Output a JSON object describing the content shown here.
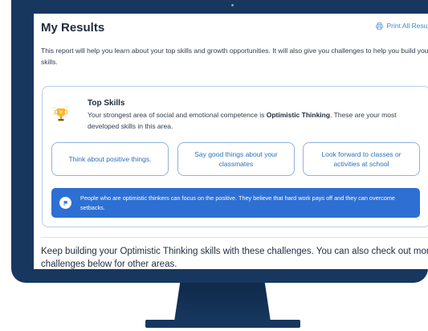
{
  "page": {
    "title": "My Results",
    "print_label": "Print All Results",
    "intro": "This report will help you learn about your top skills and growth opportunities. It will also give you challenges to help you build your skills."
  },
  "top_skills": {
    "heading": "Top Skills",
    "desc_before": "Your strongest area of social and emotional competence is ",
    "area": "Optimistic Thinking",
    "desc_after": ". These are your most developed skills in this area.",
    "skills": [
      "Think about positive things.",
      "Say good things about your classmates",
      "Look forward to classes or activities at school"
    ],
    "info": "People who are optimistic thinkers can focus on the positive. They believe that hard work pays off and they can overcome setbacks."
  },
  "challenges": {
    "text": "Keep building your Optimistic Thinking skills with these challenges. You can also check out more challenges below for other areas."
  },
  "colors": {
    "frame": "#17375e",
    "accent": "#2d6fd3",
    "link": "#3a84d6"
  },
  "icons": {
    "print": "printer-icon",
    "trophy": "trophy-icon",
    "flag": "flag-icon"
  }
}
